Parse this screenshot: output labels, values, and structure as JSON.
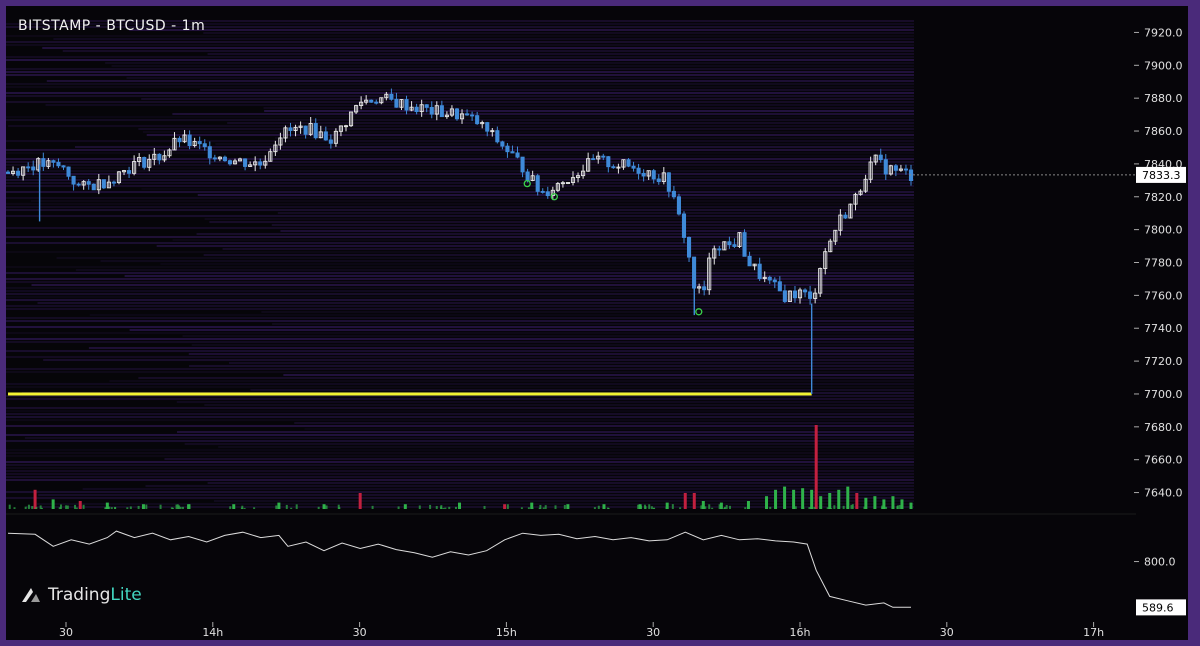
{
  "title": "BITSTAMP - BTCUSD - 1m",
  "brand": {
    "name_part1": "Trading",
    "name_part2": "Lite",
    "accent_color": "#43d7c2"
  },
  "colors": {
    "background": "#060509",
    "frame": "#4a2a7a",
    "heatmap": "#3b1d6b",
    "candle_up": "#e8e8e8",
    "candle_down": "#3f8ad8",
    "volume_up": "#2fb24a",
    "volume_down": "#c2203f",
    "support_line": "#f3f332",
    "indicator_line": "#dcdcdc",
    "marker": "#3ad24a"
  },
  "chart_data": [
    {
      "type": "candlestick",
      "title": "BITSTAMP - BTCUSD - 1m",
      "y_range": [
        7630,
        7930
      ],
      "y_ticks": [
        "7920.0",
        "7900.0",
        "7880.0",
        "7860.0",
        "7840.0",
        "7820.0",
        "7800.0",
        "7780.0",
        "7760.0",
        "7740.0",
        "7720.0",
        "7700.0",
        "7680.0",
        "7660.0",
        "7640.0"
      ],
      "x_ticks": [
        "30",
        "14h",
        "30",
        "15h",
        "30",
        "16h",
        "30",
        "17h"
      ],
      "price_label": "7833.3",
      "last_price": 7833.3,
      "support_level": 7700,
      "support_extends_to_bar": 0.89,
      "close_path": [
        [
          0.0,
          7835
        ],
        [
          0.03,
          7840
        ],
        [
          0.06,
          7838
        ],
        [
          0.08,
          7825
        ],
        [
          0.11,
          7830
        ],
        [
          0.14,
          7840
        ],
        [
          0.17,
          7845
        ],
        [
          0.19,
          7855
        ],
        [
          0.22,
          7848
        ],
        [
          0.25,
          7842
        ],
        [
          0.28,
          7840
        ],
        [
          0.3,
          7858
        ],
        [
          0.33,
          7862
        ],
        [
          0.36,
          7855
        ],
        [
          0.39,
          7878
        ],
        [
          0.41,
          7880
        ],
        [
          0.44,
          7876
        ],
        [
          0.47,
          7872
        ],
        [
          0.5,
          7870
        ],
        [
          0.52,
          7865
        ],
        [
          0.55,
          7850
        ],
        [
          0.57,
          7838
        ],
        [
          0.59,
          7822
        ],
        [
          0.61,
          7828
        ],
        [
          0.63,
          7835
        ],
        [
          0.65,
          7842
        ],
        [
          0.67,
          7840
        ],
        [
          0.69,
          7838
        ],
        [
          0.71,
          7835
        ],
        [
          0.73,
          7830
        ],
        [
          0.75,
          7795
        ],
        [
          0.76,
          7765
        ],
        [
          0.77,
          7760
        ],
        [
          0.78,
          7790
        ],
        [
          0.79,
          7792
        ],
        [
          0.8,
          7790
        ],
        [
          0.81,
          7795
        ],
        [
          0.82,
          7780
        ],
        [
          0.84,
          7768
        ],
        [
          0.86,
          7760
        ],
        [
          0.88,
          7762
        ],
        [
          0.89,
          7755
        ],
        [
          0.9,
          7780
        ],
        [
          0.92,
          7805
        ],
        [
          0.94,
          7820
        ],
        [
          0.95,
          7835
        ],
        [
          0.96,
          7842
        ],
        [
          0.97,
          7838
        ],
        [
          0.99,
          7835
        ],
        [
          1.0,
          7833
        ]
      ],
      "low_wicks": [
        {
          "at": 0.035,
          "low": 7805
        },
        {
          "at": 0.76,
          "low": 7748
        },
        {
          "at": 0.89,
          "low": 7700
        }
      ],
      "markers": [
        {
          "at": 0.575,
          "price": 7828
        },
        {
          "at": 0.605,
          "price": 7820
        },
        {
          "at": 0.765,
          "price": 7750
        }
      ]
    },
    {
      "type": "bar",
      "name": "volume",
      "values": [
        [
          0.03,
          12
        ],
        [
          0.05,
          6
        ],
        [
          0.08,
          5
        ],
        [
          0.11,
          4
        ],
        [
          0.15,
          3
        ],
        [
          0.2,
          3
        ],
        [
          0.25,
          3
        ],
        [
          0.3,
          4
        ],
        [
          0.35,
          3
        ],
        [
          0.39,
          10
        ],
        [
          0.44,
          3
        ],
        [
          0.5,
          4
        ],
        [
          0.55,
          3
        ],
        [
          0.58,
          4
        ],
        [
          0.62,
          3
        ],
        [
          0.66,
          3
        ],
        [
          0.7,
          3
        ],
        [
          0.73,
          4
        ],
        [
          0.75,
          10
        ],
        [
          0.76,
          10
        ],
        [
          0.77,
          5
        ],
        [
          0.79,
          4
        ],
        [
          0.82,
          5
        ],
        [
          0.84,
          8
        ],
        [
          0.85,
          12
        ],
        [
          0.86,
          14
        ],
        [
          0.87,
          12
        ],
        [
          0.88,
          13
        ],
        [
          0.89,
          12
        ],
        [
          0.895,
          30
        ],
        [
          0.9,
          8
        ],
        [
          0.91,
          10
        ],
        [
          0.92,
          12
        ],
        [
          0.93,
          14
        ],
        [
          0.94,
          10
        ],
        [
          0.95,
          7
        ],
        [
          0.96,
          8
        ],
        [
          0.97,
          6
        ],
        [
          0.98,
          8
        ],
        [
          0.99,
          6
        ],
        [
          1.0,
          4
        ]
      ],
      "down_positions": [
        0.03,
        0.08,
        0.39,
        0.55,
        0.75,
        0.76,
        0.895,
        0.94
      ]
    },
    {
      "type": "line",
      "name": "indicator",
      "y_ticks": [
        "800.0"
      ],
      "value_label": "589.6",
      "last_value": 589.6,
      "y_range": [
        550,
        1000
      ],
      "values": [
        [
          0.0,
          930
        ],
        [
          0.03,
          925
        ],
        [
          0.05,
          870
        ],
        [
          0.07,
          900
        ],
        [
          0.09,
          880
        ],
        [
          0.11,
          910
        ],
        [
          0.12,
          940
        ],
        [
          0.14,
          910
        ],
        [
          0.16,
          930
        ],
        [
          0.18,
          900
        ],
        [
          0.2,
          915
        ],
        [
          0.22,
          890
        ],
        [
          0.24,
          920
        ],
        [
          0.26,
          935
        ],
        [
          0.28,
          910
        ],
        [
          0.3,
          920
        ],
        [
          0.31,
          870
        ],
        [
          0.33,
          890
        ],
        [
          0.35,
          850
        ],
        [
          0.37,
          885
        ],
        [
          0.39,
          860
        ],
        [
          0.41,
          880
        ],
        [
          0.43,
          855
        ],
        [
          0.45,
          840
        ],
        [
          0.47,
          820
        ],
        [
          0.49,
          845
        ],
        [
          0.51,
          830
        ],
        [
          0.53,
          850
        ],
        [
          0.55,
          900
        ],
        [
          0.57,
          930
        ],
        [
          0.59,
          920
        ],
        [
          0.61,
          925
        ],
        [
          0.63,
          905
        ],
        [
          0.65,
          915
        ],
        [
          0.67,
          900
        ],
        [
          0.69,
          910
        ],
        [
          0.71,
          895
        ],
        [
          0.73,
          900
        ],
        [
          0.75,
          935
        ],
        [
          0.77,
          900
        ],
        [
          0.79,
          920
        ],
        [
          0.81,
          900
        ],
        [
          0.83,
          905
        ],
        [
          0.85,
          895
        ],
        [
          0.87,
          890
        ],
        [
          0.885,
          880
        ],
        [
          0.895,
          760
        ],
        [
          0.91,
          640
        ],
        [
          0.93,
          620
        ],
        [
          0.95,
          600
        ],
        [
          0.97,
          610
        ],
        [
          0.98,
          590
        ],
        [
          1.0,
          590
        ]
      ]
    }
  ]
}
